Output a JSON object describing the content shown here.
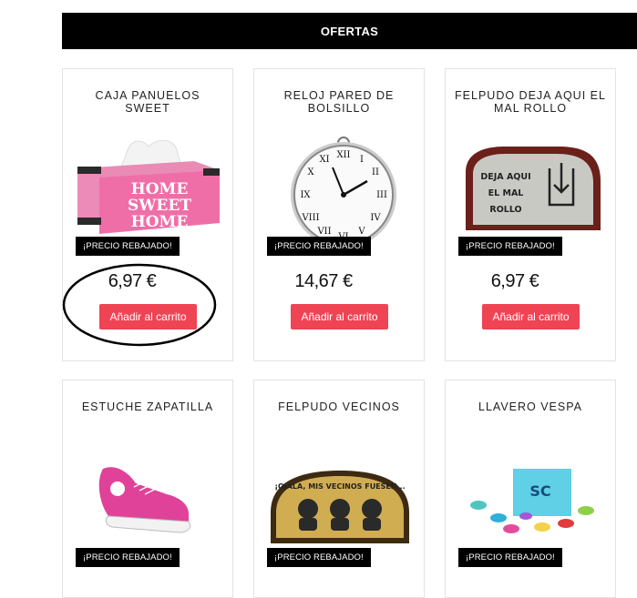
{
  "header": {
    "title": "OFERTAS"
  },
  "products": [
    {
      "name": "CAJA PANUELOS SWEET",
      "badge": "¡PRECIO REBAJADO!",
      "price": "6,97 €",
      "cart": "Añadir al carrito",
      "box_text": [
        "HOME",
        "SWEET",
        "HOME"
      ]
    },
    {
      "name": "RELOJ PARED DE BOLSILLO",
      "badge": "¡PRECIO REBAJADO!",
      "price": "14,67 €",
      "cart": "Añadir al carrito"
    },
    {
      "name": "FELPUDO DEJA AQUI EL MAL ROLLO",
      "badge": "¡PRECIO REBAJADO!",
      "price": "6,97 €",
      "cart": "Añadir al carrito",
      "mat_text": [
        "DEJA AQUI",
        "EL MAL",
        "ROLLO"
      ]
    },
    {
      "name": "ESTUCHE ZAPATILLA",
      "badge": "¡PRECIO REBAJADO!"
    },
    {
      "name": "FELPUDO VECINOS",
      "badge": "¡PRECIO REBAJADO!",
      "mat_text": "¡OJALA, MIS VECINOS FUESEN..."
    },
    {
      "name": "LLAVERO VESPA",
      "badge": "¡PRECIO REBAJADO!",
      "box_text": "SC"
    }
  ]
}
